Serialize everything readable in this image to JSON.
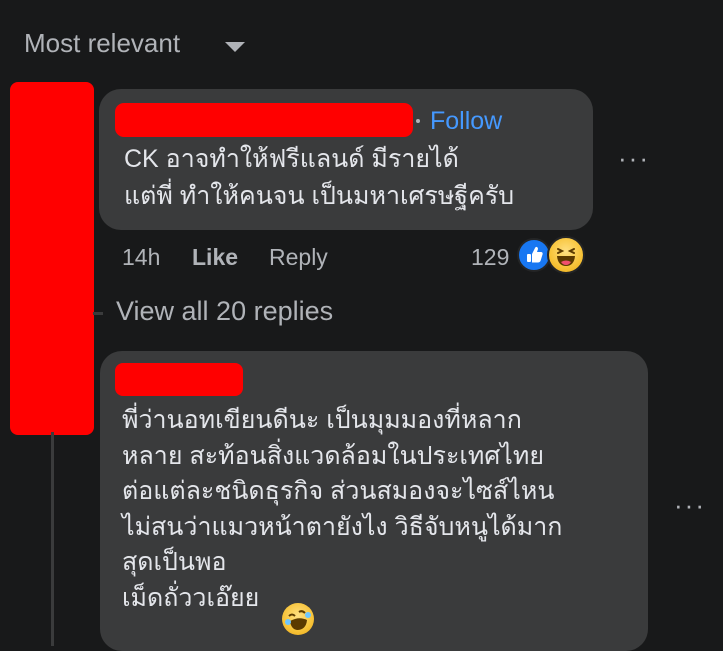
{
  "sort": {
    "label": "Most relevant",
    "caret_icon": "chevron-down-icon"
  },
  "comment1": {
    "follow_label": "Follow",
    "text": "CK อาจทำให้ฟรีแลนด์ มีรายได้\nแต่พี่ ทำให้คนจน เป็นมหาเศรษฐีครับ",
    "more": "···",
    "time": "14h",
    "like_label": "Like",
    "reply_label": "Reply",
    "reaction_count": "129",
    "reactions": [
      "like-icon",
      "haha-icon"
    ]
  },
  "replies": {
    "view_all_label": "View all 20 replies"
  },
  "comment2": {
    "text": "พี่ว่านอทเขียนดีนะ เป็นมุมมองที่หลาก\nหลาย สะท้อนสิ่งแวดล้อมในประเทศไทย\nต่อแต่ละชนิดธุรกิจ ส่วนสมองจะไซส์ไหน\nไม่สนว่าแมวหน้าตายังไง วิธีจับหนูได้มาก\nสุดเป็นพอ\nเม็ดถั่ววเอ๊ยย",
    "emoji": "rolling-laughing-icon",
    "more": "···"
  },
  "colors": {
    "background": "#18191a",
    "bubble": "#3a3b3c",
    "accent": "#4599ff",
    "redaction": "#ff0000"
  }
}
